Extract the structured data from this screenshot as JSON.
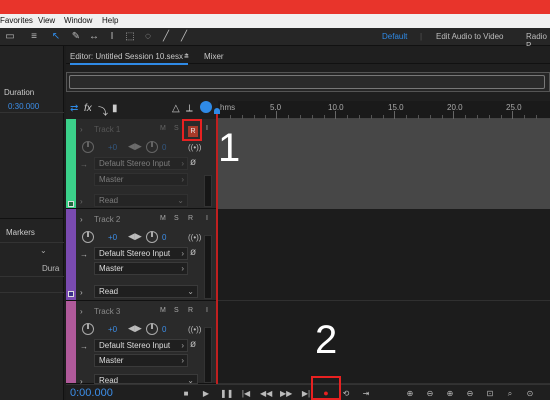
{
  "menubar": {
    "items": [
      "Favorites",
      "View",
      "Window",
      "Help"
    ]
  },
  "workspaces": {
    "items": [
      "Default",
      "Edit Audio to Video",
      "Radio P"
    ],
    "active": "Default"
  },
  "tabs": {
    "editor": "Editor: Untitled Session 10.sesx *",
    "menu_icon": "≡",
    "mixer": "Mixer"
  },
  "left_panel": {
    "duration_header": "Duration",
    "duration_value": "0:30.000",
    "markers": "Markers",
    "dura": "Dura"
  },
  "ruler": {
    "labels": [
      "hms",
      "5.0",
      "10.0",
      "15.0",
      "20.0",
      "25.0"
    ]
  },
  "tracks": [
    {
      "name": "Track 1",
      "m": "M",
      "s": "S",
      "r": "R",
      "i": "I",
      "volume": "+0",
      "pan": "0",
      "input": "Default Stereo Input",
      "output": "Master",
      "automation": "Read",
      "color": "#3bd18a"
    },
    {
      "name": "Track 2",
      "m": "M",
      "s": "S",
      "r": "R",
      "i": "I",
      "volume": "+0",
      "pan": "0",
      "input": "Default Stereo Input",
      "output": "Master",
      "automation": "Read",
      "color": "#7a4bb0"
    },
    {
      "name": "Track 3",
      "m": "M",
      "s": "S",
      "r": "R",
      "i": "I",
      "volume": "+0",
      "pan": "0",
      "input": "Default Stereo Input",
      "output": "Master",
      "automation": "Read",
      "color": "#b05a9a"
    }
  ],
  "annotations": {
    "one": "1",
    "two": "2"
  },
  "transport": {
    "timecode": "0:00.000"
  },
  "colors": {
    "accent": "#2f8ae6",
    "highlight": "#e82121",
    "record": "#e82121"
  }
}
